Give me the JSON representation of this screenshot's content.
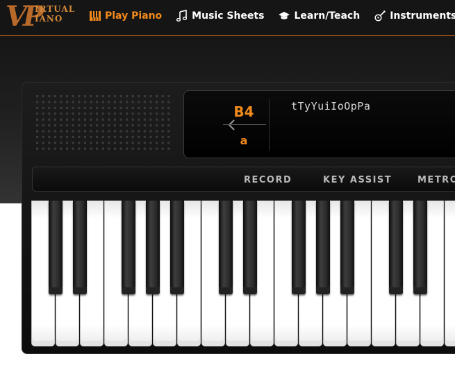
{
  "brand": {
    "logo_letters": "VP",
    "logo_line1": "IRTUAL",
    "logo_line2": "IANO"
  },
  "nav": {
    "items": [
      {
        "label": "Play Piano",
        "icon": "piano-icon",
        "active": true
      },
      {
        "label": "Music Sheets",
        "icon": "music-note-icon",
        "active": false
      },
      {
        "label": "Learn/Teach",
        "icon": "graduation-cap-icon",
        "active": false
      },
      {
        "label": "Instruments",
        "icon": "guitar-icon",
        "active": false
      }
    ]
  },
  "display": {
    "note": "B4",
    "key": "a",
    "sequence": "tTyYuiIoOpPa",
    "prev_icon": "chevron-left-icon"
  },
  "controls": {
    "record": "RECORD",
    "key_assist": "KEY ASSIST",
    "metronome": "METRONOME"
  },
  "colors": {
    "accent": "#f28a1c",
    "header_bg": "#151515",
    "piano_body": "#111111"
  }
}
